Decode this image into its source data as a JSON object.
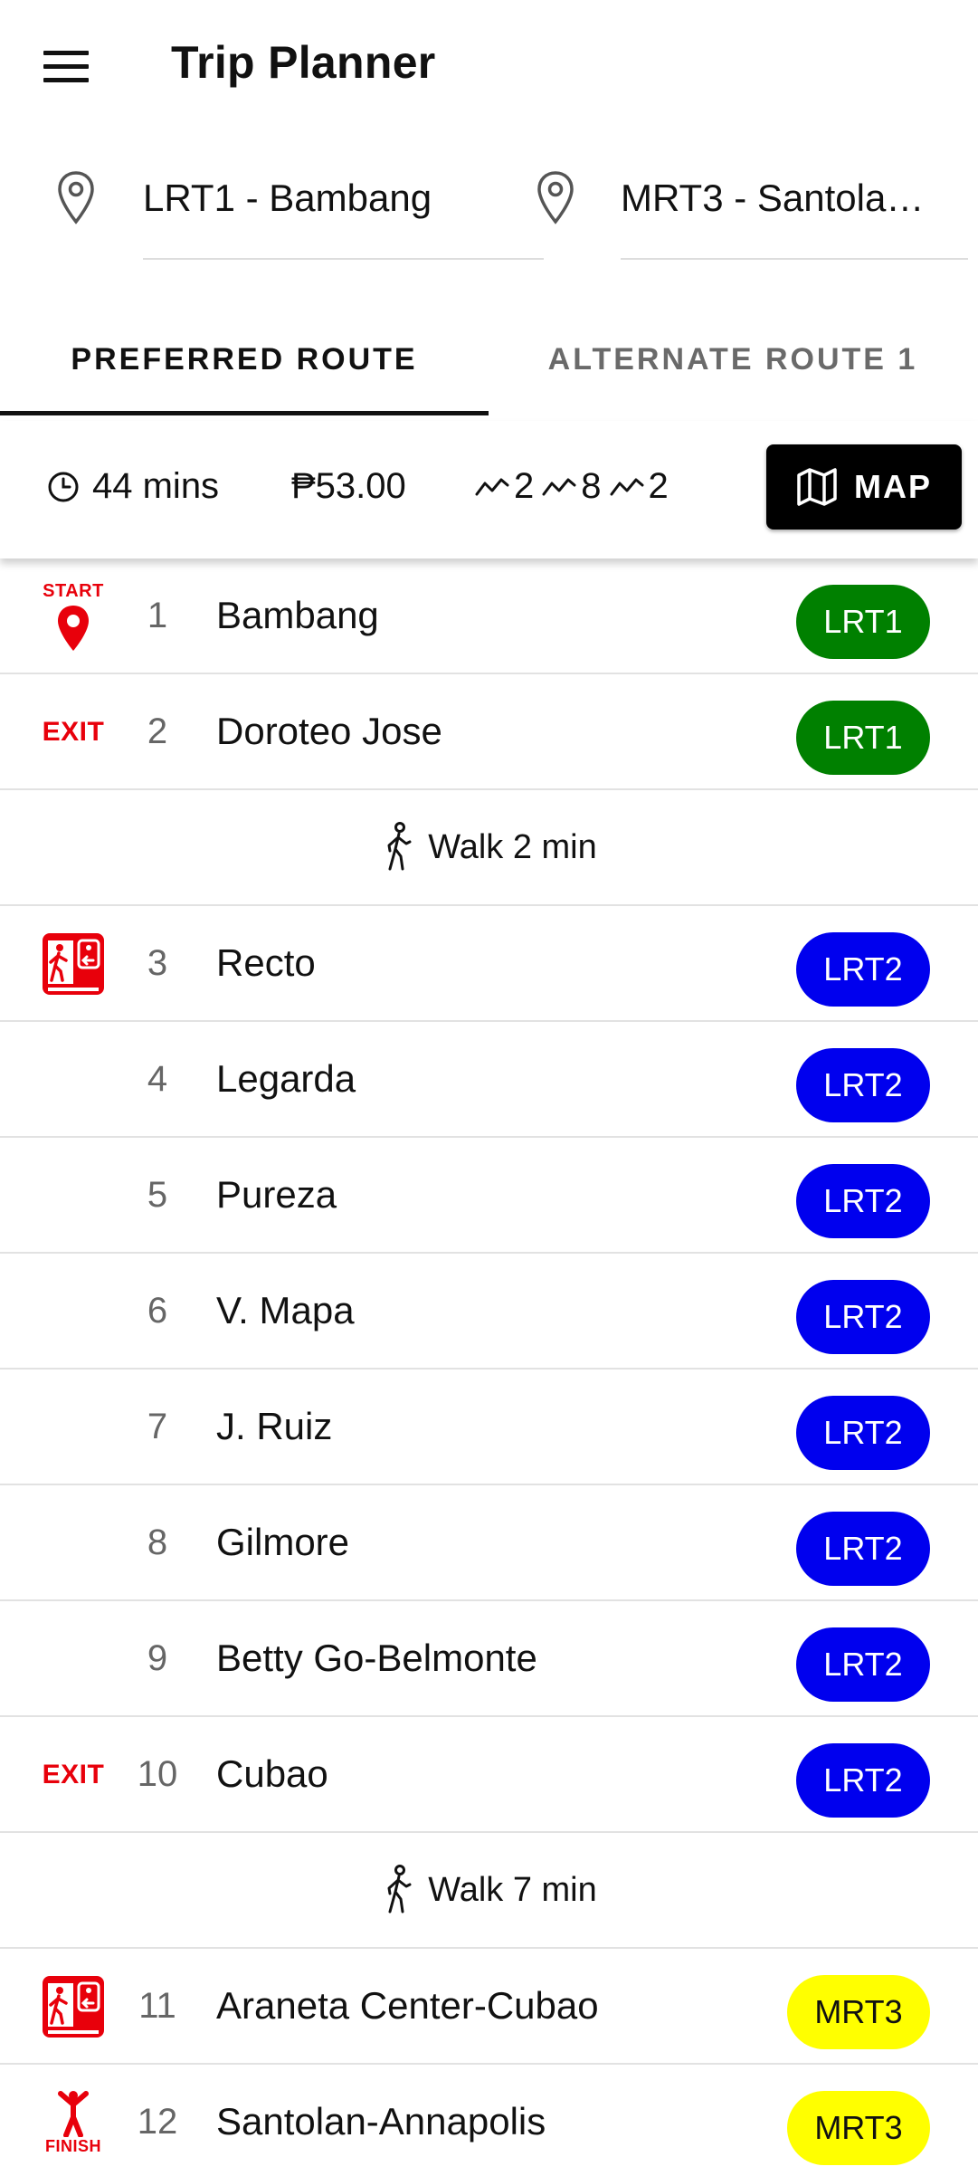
{
  "header": {
    "title": "Trip Planner",
    "menu_icon": "hamburger-menu-icon"
  },
  "stations": {
    "from": {
      "icon": "location-pin-icon",
      "value": "LRT1 - Bambang"
    },
    "to": {
      "icon": "location-pin-icon",
      "value": "MRT3 - Santolan..."
    }
  },
  "tabs": [
    {
      "label": "PREFERRED ROUTE",
      "active": true
    },
    {
      "label": "ALTERNATE ROUTE 1",
      "active": false
    }
  ],
  "summary": {
    "duration": "44 mins",
    "fare": "₱53.00",
    "counts": [
      "2",
      "8",
      "2"
    ],
    "map_label": "MAP"
  },
  "colors": {
    "LRT1": "#008000",
    "LRT2": "#0000ee",
    "MRT3": "#ffff00",
    "accent_red": "#e8000b"
  },
  "route": [
    {
      "type": "stop",
      "marker": "start",
      "marker_label": "START",
      "number": "1",
      "name": "Bambang",
      "line": "LRT1"
    },
    {
      "type": "stop",
      "marker": "exit",
      "marker_label": "EXIT",
      "number": "2",
      "name": "Doroteo Jose",
      "line": "LRT1"
    },
    {
      "type": "walk",
      "text": "Walk 2 min"
    },
    {
      "type": "stop",
      "marker": "transfer",
      "number": "3",
      "name": "Recto",
      "line": "LRT2"
    },
    {
      "type": "stop",
      "marker": "",
      "number": "4",
      "name": "Legarda",
      "line": "LRT2"
    },
    {
      "type": "stop",
      "marker": "",
      "number": "5",
      "name": "Pureza",
      "line": "LRT2"
    },
    {
      "type": "stop",
      "marker": "",
      "number": "6",
      "name": "V. Mapa",
      "line": "LRT2"
    },
    {
      "type": "stop",
      "marker": "",
      "number": "7",
      "name": "J. Ruiz",
      "line": "LRT2"
    },
    {
      "type": "stop",
      "marker": "",
      "number": "8",
      "name": "Gilmore",
      "line": "LRT2"
    },
    {
      "type": "stop",
      "marker": "",
      "number": "9",
      "name": "Betty Go-Belmonte",
      "line": "LRT2"
    },
    {
      "type": "stop",
      "marker": "exit",
      "marker_label": "EXIT",
      "number": "10",
      "name": "Cubao",
      "line": "LRT2"
    },
    {
      "type": "walk",
      "text": "Walk 7 min"
    },
    {
      "type": "stop",
      "marker": "transfer",
      "number": "11",
      "name": "Araneta Center-Cubao",
      "line": "MRT3"
    },
    {
      "type": "stop",
      "marker": "finish",
      "marker_label": "FINISH",
      "number": "12",
      "name": "Santolan-Annapolis",
      "line": "MRT3"
    }
  ]
}
